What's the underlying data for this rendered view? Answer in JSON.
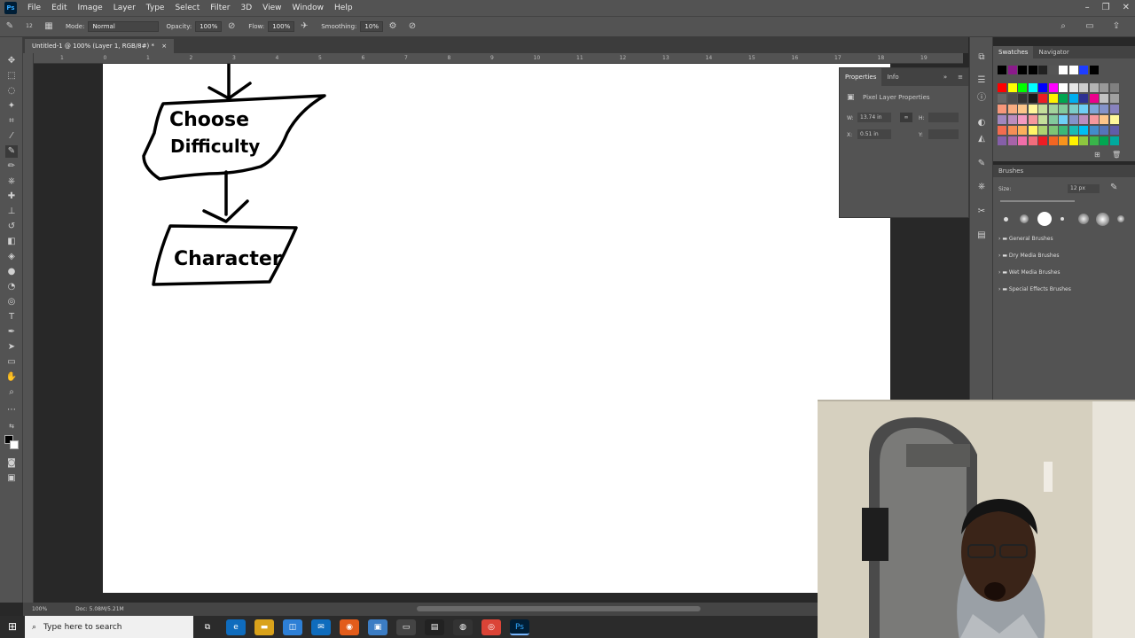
{
  "menubar": {
    "logo": "Ps",
    "items": [
      "File",
      "Edit",
      "Image",
      "Layer",
      "Type",
      "Select",
      "Filter",
      "3D",
      "View",
      "Window",
      "Help"
    ]
  },
  "optionsbar": {
    "brush_size": "12",
    "mode_label": "Mode:",
    "mode_value": "Normal",
    "opacity_label": "Opacity:",
    "opacity_value": "100%",
    "flow_label": "Flow:",
    "flow_value": "100%",
    "smoothing_label": "Smoothing:",
    "smoothing_value": "10%"
  },
  "document": {
    "tab_title": "Untitled-1 @ 100% (Layer 1, RGB/8#) *"
  },
  "ruler": {
    "h_ticks": [
      "1",
      "0",
      "1",
      "2",
      "3",
      "4",
      "5",
      "6",
      "7",
      "8",
      "9",
      "10",
      "11",
      "12",
      "13",
      "14",
      "15",
      "16",
      "17",
      "18",
      "19",
      "20"
    ]
  },
  "canvas_drawing": {
    "shape1_text_line1": "Choose",
    "shape1_text_line2": "Difficulty",
    "shape2_text": "Character"
  },
  "statusbar": {
    "zoom": "100%",
    "doc_size": "Doc: 5.08M/5.21M"
  },
  "properties": {
    "tab_properties": "Properties",
    "tab_info": "Info",
    "section_title": "Pixel Layer Properties",
    "w_label": "W:",
    "w_value": "13.74 in",
    "h_label": "H:",
    "x_label": "X:",
    "x_value": "0.51 in",
    "y_label": "Y:"
  },
  "swatches": {
    "tab_swatches": "Swatches",
    "tab_navigator": "Navigator",
    "row1": [
      "#000000",
      "#8b1a8b",
      "#000000",
      "#000000",
      "#222222",
      "#555555",
      "#ffffff",
      "#ffffff",
      "#1e3dff",
      "#000000"
    ],
    "rows": [
      [
        "#ff0000",
        "#ffff00",
        "#00ff00",
        "#00ffff",
        "#0000ff",
        "#ff00ff",
        "#ffffff",
        "#e6e6e6",
        "#cccccc",
        "#b3b3b3",
        "#999999",
        "#808080"
      ],
      [
        "#666666",
        "#4d4d4d",
        "#333333",
        "#1a1a1a",
        "#ed1c24",
        "#fff200",
        "#00a651",
        "#00aeef",
        "#2e3192",
        "#ec008c",
        "#c2c2c2",
        "#a0a0a0"
      ],
      [
        "#f7977a",
        "#f9ad81",
        "#fdc68a",
        "#fff79a",
        "#c4df9b",
        "#a3d39c",
        "#82ca9d",
        "#7bcdc8",
        "#6ecff6",
        "#7ea7d8",
        "#8493ca",
        "#8882be"
      ],
      [
        "#a187be",
        "#bc8dbf",
        "#f49ac2",
        "#f6989d",
        "#c4df9b",
        "#82ca9d",
        "#6ecff6",
        "#8493ca",
        "#bc8dbf",
        "#f6989d",
        "#fdc68a",
        "#fff79a"
      ],
      [
        "#f26c4f",
        "#f68e55",
        "#fbaf5c",
        "#fff467",
        "#acd372",
        "#7cc576",
        "#3bb878",
        "#1abbb4",
        "#00bff3",
        "#438cca",
        "#5574b9",
        "#605ca8"
      ],
      [
        "#855fa8",
        "#a763a8",
        "#f06ea9",
        "#f26d7d",
        "#ed1c24",
        "#f26522",
        "#f7941d",
        "#fff200",
        "#8dc73f",
        "#39b54a",
        "#00a651",
        "#00a99d"
      ]
    ]
  },
  "brushes": {
    "tab": "Brushes",
    "size_label": "Size:",
    "size_value": "12 px",
    "folders": [
      "General Brushes",
      "Dry Media Brushes",
      "Wet Media Brushes",
      "Special Effects Brushes"
    ]
  },
  "taskbar": {
    "search_placeholder": "Type here to search"
  }
}
